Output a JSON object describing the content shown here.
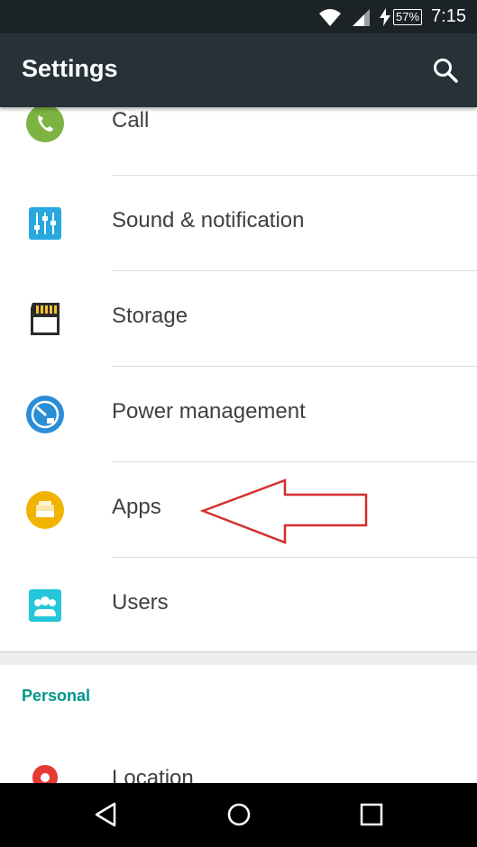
{
  "status_bar": {
    "battery": "57%",
    "time": "7:15"
  },
  "app_bar": {
    "title": "Settings"
  },
  "items": [
    {
      "label": "Call"
    },
    {
      "label": "Sound & notification"
    },
    {
      "label": "Storage"
    },
    {
      "label": "Power management"
    },
    {
      "label": "Apps"
    },
    {
      "label": "Users"
    }
  ],
  "personal": {
    "header": "Personal",
    "items": [
      {
        "label": "Location"
      }
    ]
  },
  "colors": {
    "status_bar": "#1b2327",
    "app_bar": "#263238",
    "accent": "#009688",
    "annotation_arrow": "#d32f2f"
  }
}
